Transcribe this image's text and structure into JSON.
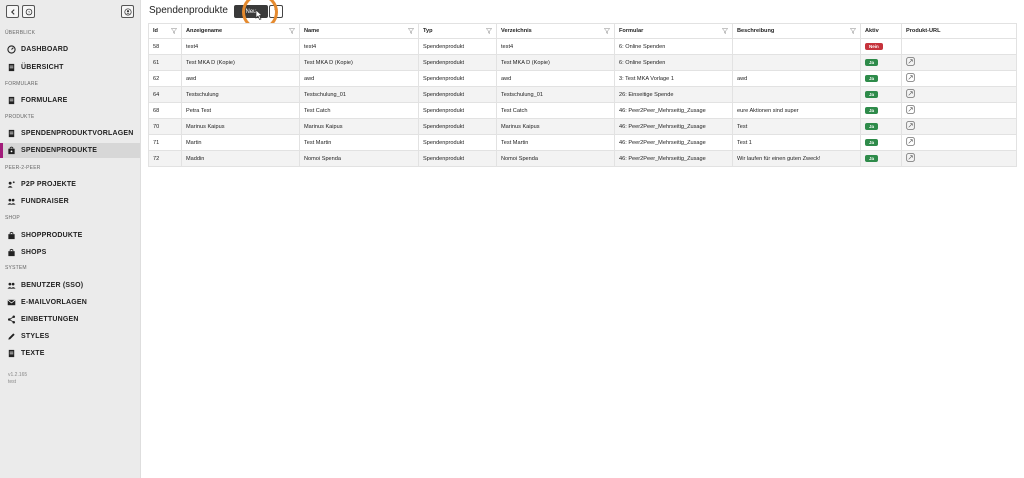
{
  "sidebar": {
    "sections": {
      "ueberblick": "ÜBERBLICK",
      "formulare": "FORMULARE",
      "produkte": "PRODUKTE",
      "p2p": "PEER-2-PEER",
      "shop": "SHOP",
      "system": "SYSTEM"
    },
    "items": {
      "dashboard": "DASHBOARD",
      "uebersicht": "ÜBERSICHT",
      "formulare": "FORMULARE",
      "vorlagen": "SPENDENPRODUKTVORLAGEN",
      "spendenprodukte": "SPENDENPRODUKTE",
      "p2p_projekte": "P2P PROJEKTE",
      "fundraiser": "FUNDRAISER",
      "shopprodukte": "SHOPPRODUKTE",
      "shops": "SHOPS",
      "benutzer": "BENUTZER (SSO)",
      "emailvorlagen": "E-MAILVORLAGEN",
      "einbettungen": "EINBETTUNGEN",
      "styles": "STYLES",
      "texte": "TEXTE"
    },
    "version": "v1.2.165",
    "version_sub": "test"
  },
  "header": {
    "title": "Spendenprodukte",
    "new_label": "Neu",
    "help_label": "?"
  },
  "table": {
    "columns": {
      "id": "Id",
      "anzeigename": "Anzeigename",
      "name": "Name",
      "typ": "Typ",
      "verzeichnis": "Verzeichnis",
      "formular": "Formular",
      "beschreibung": "Beschreibung",
      "aktiv": "Aktiv",
      "url": "Produkt-URL"
    },
    "rows": [
      {
        "id": "58",
        "anzeigename": "test4",
        "name": "test4",
        "typ": "Spendenprodukt",
        "verzeichnis": "test4",
        "formular": "6: Online Spenden",
        "beschreibung": "",
        "aktiv": "Nein"
      },
      {
        "id": "61",
        "anzeigename": "Test MKA D (Kopie)",
        "name": "Test MKA D (Kopie)",
        "typ": "Spendenprodukt",
        "verzeichnis": "Test MKA D (Kopie)",
        "formular": "6: Online Spenden",
        "beschreibung": "",
        "aktiv": "Ja"
      },
      {
        "id": "62",
        "anzeigename": "awd",
        "name": "awd",
        "typ": "Spendenprodukt",
        "verzeichnis": "awd",
        "formular": "3: Test MKA Vorlage 1",
        "beschreibung": "awd",
        "aktiv": "Ja"
      },
      {
        "id": "64",
        "anzeigename": "Testschulung",
        "name": "Testschulung_01",
        "typ": "Spendenprodukt",
        "verzeichnis": "Testschulung_01",
        "formular": "26: Einseitige Spende",
        "beschreibung": "",
        "aktiv": "Ja"
      },
      {
        "id": "68",
        "anzeigename": "Petra Test",
        "name": "Test Catch",
        "typ": "Spendenprodukt",
        "verzeichnis": "Test Catch",
        "formular": "46: Peer2Peer_Mehrseitig_Zusage",
        "beschreibung": "eure Aktionen sind super",
        "aktiv": "Ja"
      },
      {
        "id": "70",
        "anzeigename": "Marinus Kaipus",
        "name": "Marinus Kaipus",
        "typ": "Spendenprodukt",
        "verzeichnis": "Marinus Kaipus",
        "formular": "46: Peer2Peer_Mehrseitig_Zusage",
        "beschreibung": "Test",
        "aktiv": "Ja"
      },
      {
        "id": "71",
        "anzeigename": "Martin",
        "name": "Test Martin",
        "typ": "Spendenprodukt",
        "verzeichnis": "Test Martin",
        "formular": "46: Peer2Peer_Mehrseitig_Zusage",
        "beschreibung": "Test 1",
        "aktiv": "Ja"
      },
      {
        "id": "72",
        "anzeigename": "Maddin",
        "name": "Nomoi Spenda",
        "typ": "Spendenprodukt",
        "verzeichnis": "Nomoi Spenda",
        "formular": "46: Peer2Peer_Mehrseitig_Zusage",
        "beschreibung": "Wir laufen für einen guten Zweck!",
        "aktiv": "Ja"
      }
    ]
  },
  "colors": {
    "accent": "#a21c7a",
    "ja": "#2e8b4a",
    "nein": "#c6333c",
    "highlight": "#e58a2e"
  },
  "icons": [
    "back-icon",
    "help-icon",
    "user-icon",
    "dashboard-icon",
    "document-icon",
    "lock-bag-icon",
    "users-icon",
    "bag-icon",
    "mail-icon",
    "share-icon",
    "pen-icon",
    "filter-icon",
    "external-link-icon"
  ]
}
